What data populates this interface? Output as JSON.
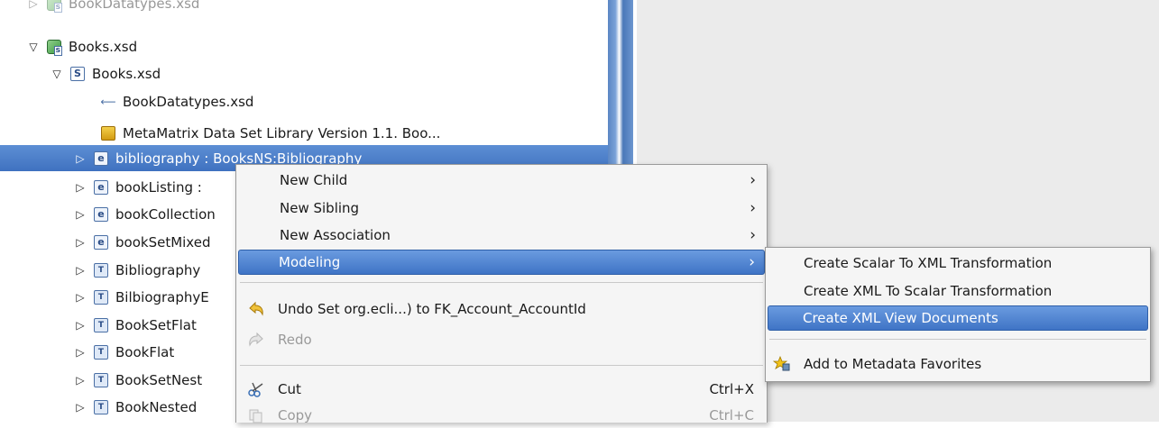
{
  "tree": {
    "rows": [
      {
        "label": "BookDatatypes.xsd",
        "twisty": "▷",
        "icon": "xsd-model-icon"
      },
      {
        "label": "Books.xsd",
        "twisty": "▽",
        "icon": "xsd-model-icon"
      },
      {
        "label": "Books.xsd",
        "twisty": "▽",
        "icon": "schema-icon",
        "icon_text": "S"
      },
      {
        "label": "BookDatatypes.xsd",
        "twisty": "",
        "icon": "import-icon",
        "icon_text": "⟵"
      },
      {
        "label": "MetaMatrix Data Set Library Version 1.1. Boo...",
        "twisty": "",
        "icon": "annotation-icon"
      },
      {
        "label": "bibliography : BooksNS:Bibliography",
        "twisty": "▷",
        "icon": "element-icon",
        "icon_text": "e"
      },
      {
        "label": "bookListing :",
        "twisty": "▷",
        "icon": "element-icon",
        "icon_text": "e"
      },
      {
        "label": "bookCollection",
        "twisty": "▷",
        "icon": "element-icon",
        "icon_text": "e"
      },
      {
        "label": "bookSetMixed",
        "twisty": "▷",
        "icon": "element-icon",
        "icon_text": "e"
      },
      {
        "label": "Bibliography",
        "twisty": "▷",
        "icon": "complex-type-icon",
        "icon_text": "T"
      },
      {
        "label": "BilbiographyE",
        "twisty": "▷",
        "icon": "complex-type-icon",
        "icon_text": "T"
      },
      {
        "label": "BookSetFlat",
        "twisty": "▷",
        "icon": "complex-type-icon",
        "icon_text": "T"
      },
      {
        "label": "BookFlat",
        "twisty": "▷",
        "icon": "complex-type-icon",
        "icon_text": "T"
      },
      {
        "label": "BookSetNest",
        "twisty": "▷",
        "icon": "complex-type-icon",
        "icon_text": "T"
      },
      {
        "label": "BookNested",
        "twisty": "▷",
        "icon": "complex-type-icon",
        "icon_text": "T"
      }
    ]
  },
  "context_menu": {
    "new_child": "New Child",
    "new_sibling": "New Sibling",
    "new_association": "New Association",
    "modeling": "Modeling",
    "undo": "Undo Set org.ecli...) to FK_Account_AccountId",
    "redo": "Redo",
    "cut": "Cut",
    "cut_accel": "Ctrl+X",
    "copy": "Copy",
    "copy_accel": "Ctrl+C",
    "arrow": "›"
  },
  "submenu": {
    "scalar_to_xml": "Create Scalar To XML Transformation",
    "xml_to_scalar": "Create XML To Scalar Transformation",
    "xml_view_docs": "Create XML View Documents",
    "add_favorites": "Add to Metadata Favorites"
  },
  "colors": {
    "selection": "#4a7fcb",
    "menu_bg": "#f5f5f5",
    "workspace_bg": "#ebebeb"
  }
}
